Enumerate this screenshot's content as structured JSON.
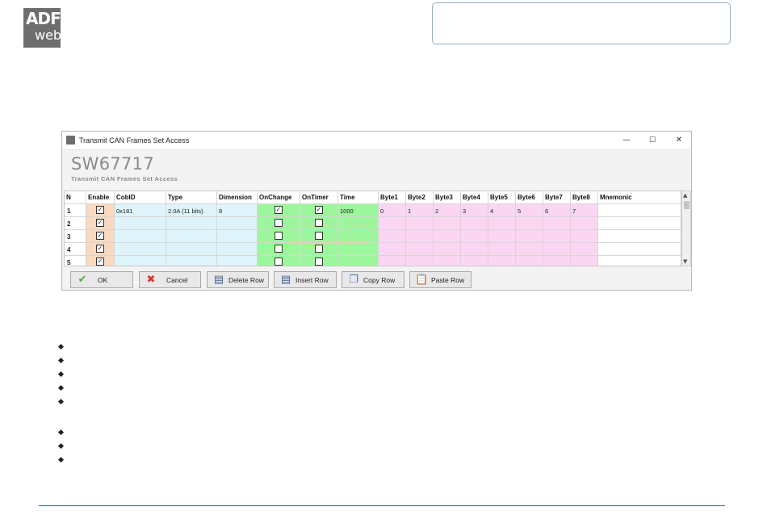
{
  "logo": {
    "line1": "ADF",
    "line2": "web"
  },
  "window": {
    "title": "Transmit CAN Frames Set Access",
    "controls": {
      "minimize": "—",
      "maximize": "☐",
      "close": "✕"
    },
    "code": "SW67717",
    "subtitle": "Transmit CAN Frames Set Access"
  },
  "table": {
    "columns": [
      "N",
      "Enable",
      "CobID",
      "Type",
      "Dimension",
      "OnChange",
      "OnTimer",
      "Time",
      "Byte1",
      "Byte2",
      "Byte3",
      "Byte4",
      "Byte5",
      "Byte6",
      "Byte7",
      "Byte8",
      "Mnemonic"
    ],
    "rows": [
      {
        "n": "1",
        "enable": true,
        "cobid": "0x181",
        "type": "2.0A (11 bits)",
        "dimension": "8",
        "onchange": true,
        "ontimer": true,
        "time": "1000",
        "b1": "0",
        "b2": "1",
        "b3": "2",
        "b4": "3",
        "b5": "4",
        "b6": "5",
        "b7": "6",
        "b8": "7",
        "mnemonic": ""
      },
      {
        "n": "2",
        "enable": true,
        "cobid": "",
        "type": "",
        "dimension": "",
        "onchange": false,
        "ontimer": false,
        "time": "",
        "b1": "",
        "b2": "",
        "b3": "",
        "b4": "",
        "b5": "",
        "b6": "",
        "b7": "",
        "b8": "",
        "mnemonic": ""
      },
      {
        "n": "3",
        "enable": true,
        "cobid": "",
        "type": "",
        "dimension": "",
        "onchange": false,
        "ontimer": false,
        "time": "",
        "b1": "",
        "b2": "",
        "b3": "",
        "b4": "",
        "b5": "",
        "b6": "",
        "b7": "",
        "b8": "",
        "mnemonic": ""
      },
      {
        "n": "4",
        "enable": true,
        "cobid": "",
        "type": "",
        "dimension": "",
        "onchange": false,
        "ontimer": false,
        "time": "",
        "b1": "",
        "b2": "",
        "b3": "",
        "b4": "",
        "b5": "",
        "b6": "",
        "b7": "",
        "b8": "",
        "mnemonic": ""
      },
      {
        "n": "5",
        "enable": true,
        "cobid": "",
        "type": "",
        "dimension": "",
        "onchange": false,
        "ontimer": false,
        "time": "",
        "b1": "",
        "b2": "",
        "b3": "",
        "b4": "",
        "b5": "",
        "b6": "",
        "b7": "",
        "b8": "",
        "mnemonic": ""
      }
    ],
    "colors": {
      "enable": "#f9d9bf",
      "can": "#dff4fa",
      "flags": "#9cf79c",
      "bytes": "#fbd6f3",
      "mnemonic": "#ffffff"
    }
  },
  "buttons": [
    {
      "label": "OK",
      "icon": "check-icon",
      "glyph": "✔",
      "color": "#4caf3c"
    },
    {
      "label": "Cancel",
      "icon": "cross-icon",
      "glyph": "✖",
      "color": "#d9342b"
    },
    {
      "label": "Delete Row",
      "icon": "delete-row-icon",
      "glyph": "▤",
      "color": "#3b5f9a"
    },
    {
      "label": "Insert Row",
      "icon": "insert-row-icon",
      "glyph": "▤",
      "color": "#3b5f9a"
    },
    {
      "label": "Copy Row",
      "icon": "copy-row-icon",
      "glyph": "❐",
      "color": "#4a77b8"
    },
    {
      "label": "Paste Row",
      "icon": "paste-row-icon",
      "glyph": "📋",
      "color": "#c58b2c"
    }
  ],
  "bullets_count": 8
}
